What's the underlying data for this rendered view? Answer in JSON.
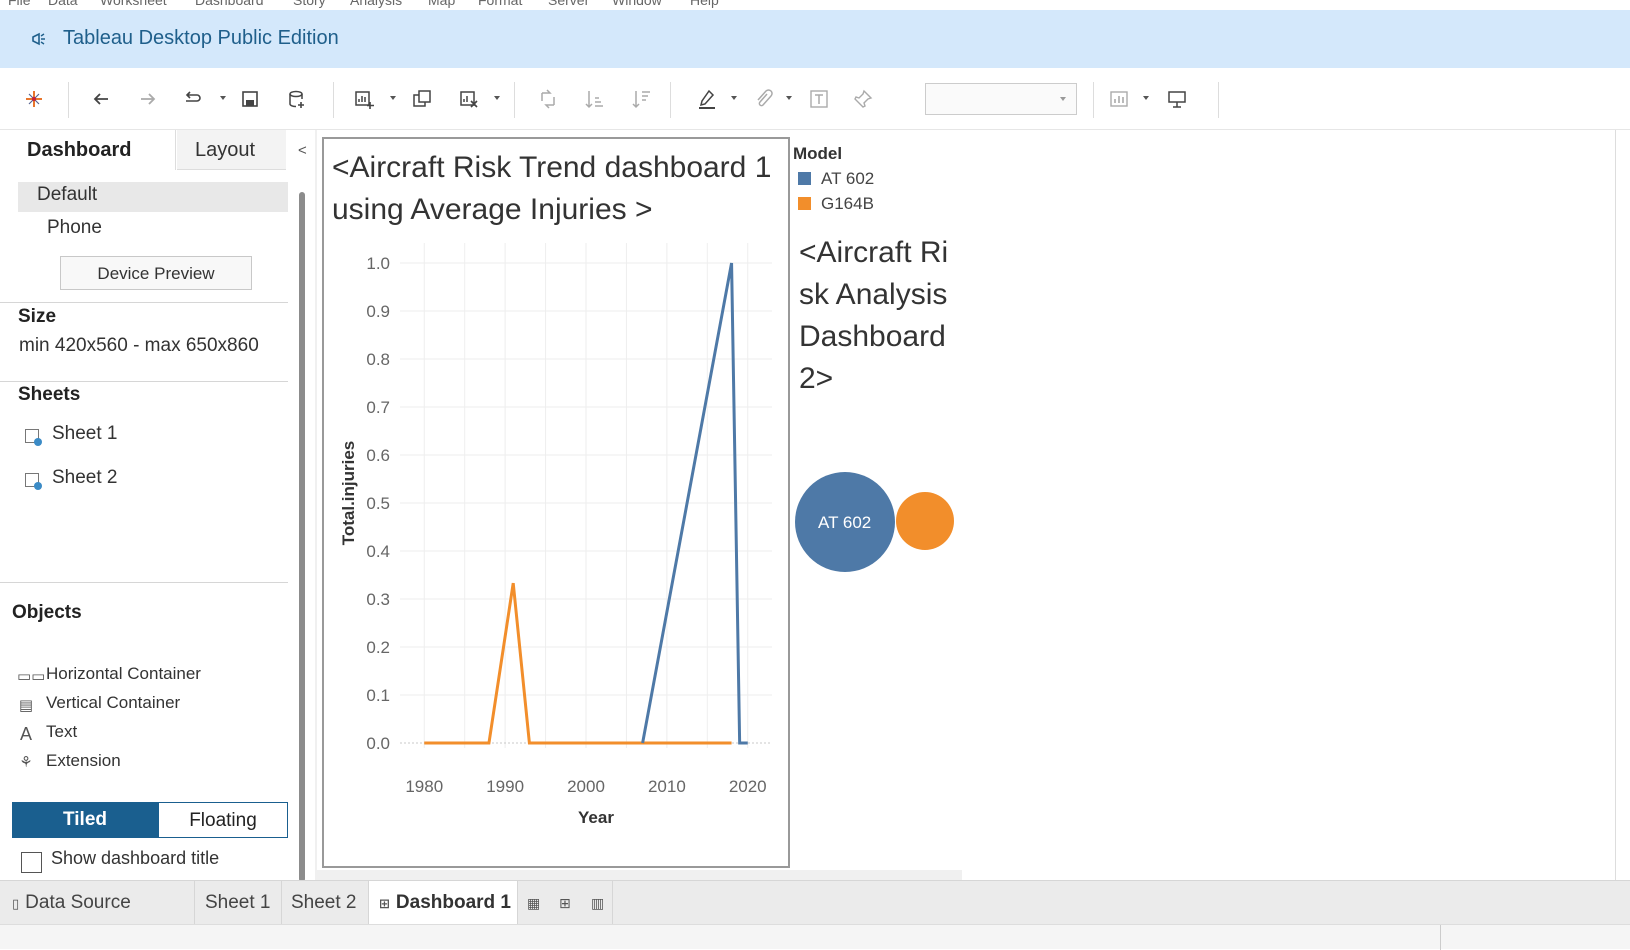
{
  "menu": [
    "File",
    "Data",
    "Worksheet",
    "Dashboard",
    "Story",
    "Analysis",
    "Map",
    "Format",
    "Server",
    "Window",
    "Help"
  ],
  "app": {
    "title": "Tableau Desktop Public Edition"
  },
  "toolbar": {
    "icons": [
      "tableau-logo-icon",
      "undo-icon",
      "redo-icon",
      "replay-icon",
      "save-icon",
      "new-data-source-icon",
      "new-worksheet-icon",
      "duplicate-icon",
      "clear-sheet-icon",
      "swap-icon",
      "sort-ascending-icon",
      "sort-descending-icon",
      "highlight-icon",
      "group-icon",
      "labels-icon",
      "pin-icon",
      "show-me-icon",
      "presentation-icon"
    ],
    "fit_select": ""
  },
  "left_panel": {
    "tabs": [
      "Dashboard",
      "Layout"
    ],
    "collapse": "<",
    "devices": [
      "Default",
      "Phone"
    ],
    "device_preview": "Device Preview",
    "size_heading": "Size",
    "size_value": "min 420x560 - max 650x860",
    "sheets_heading": "Sheets",
    "sheets": [
      "Sheet 1",
      "Sheet 2"
    ],
    "objects_heading": "Objects",
    "objects": [
      {
        "label": "Horizontal Container",
        "icon": "horizontal-container-icon"
      },
      {
        "label": "Vertical Container",
        "icon": "vertical-container-icon"
      },
      {
        "label": "Text",
        "icon": "text-icon"
      },
      {
        "label": "Extension",
        "icon": "extension-icon"
      }
    ],
    "layout_modes": [
      "Tiled",
      "Floating"
    ],
    "show_title_label": "Show dashboard title",
    "show_title_checked": false
  },
  "sheet1": {
    "title": "<Aircraft Risk Trend dashboard 1 using Average Injuries >"
  },
  "sheet2": {
    "title": "<Aircraft Risk Analysis Dashboard 2>",
    "bubble_label": "AT 602"
  },
  "legend": {
    "title": "Model",
    "items": [
      {
        "label": "AT 602",
        "color": "#4e79a7"
      },
      {
        "label": "G164B",
        "color": "#f28e2b"
      }
    ]
  },
  "chart_data": {
    "type": "line",
    "xlabel": "Year",
    "ylabel": "Total.injuries",
    "xlim": [
      1977,
      2023
    ],
    "ylim": [
      0,
      1.0
    ],
    "x_ticks": [
      1980,
      1990,
      2000,
      2010,
      2020
    ],
    "y_ticks": [
      0.0,
      0.1,
      0.2,
      0.3,
      0.4,
      0.5,
      0.6,
      0.7,
      0.8,
      0.9,
      1.0
    ],
    "grid": true,
    "legend_position": "right",
    "series": [
      {
        "name": "AT 602",
        "color": "#4e79a7",
        "x": [
          2007,
          2018,
          2019,
          2020
        ],
        "y": [
          0.0,
          1.0,
          0.0,
          0.0
        ]
      },
      {
        "name": "G164B",
        "color": "#f28e2b",
        "x": [
          1980,
          1988,
          1991,
          1993,
          2018
        ],
        "y": [
          0.0,
          0.0,
          0.333,
          0.0,
          0.0
        ]
      }
    ]
  },
  "bottom_tabs": {
    "data_source": "Data Source",
    "sheets": [
      "Sheet 1",
      "Sheet 2"
    ],
    "active": "Dashboard 1"
  }
}
